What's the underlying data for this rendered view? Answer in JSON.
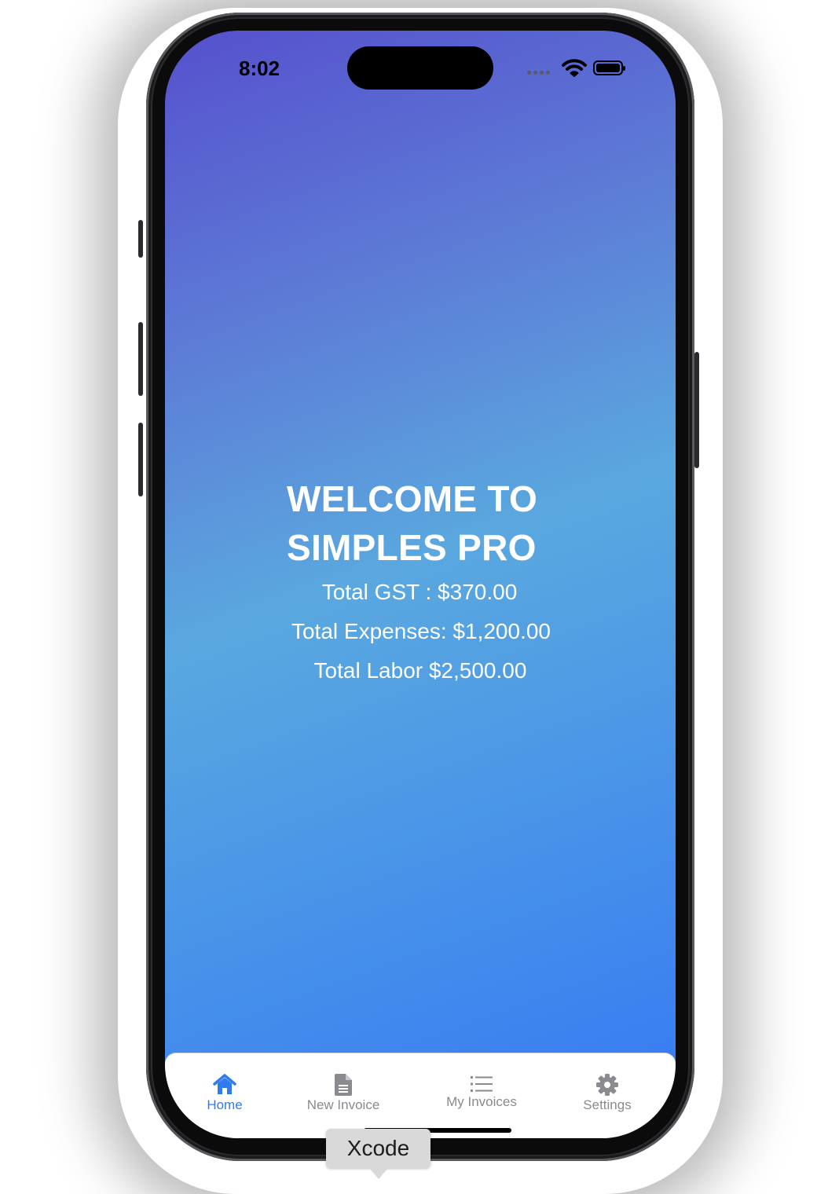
{
  "status_bar": {
    "time": "8:02"
  },
  "home": {
    "title_line1": "WELCOME TO",
    "title_line2": "SIMPLES PRO",
    "total_gst": "Total GST : $370.00",
    "total_expenses": "Total Expenses: $1,200.00",
    "total_labor": "Total Labor $2,500.00"
  },
  "tabbar": {
    "tabs": [
      {
        "label": "Home",
        "icon": "house-icon",
        "active": true
      },
      {
        "label": "New Invoice",
        "icon": "document-icon",
        "active": false
      },
      {
        "label": "My Invoices",
        "icon": "list-icon",
        "active": false
      },
      {
        "label": "Settings",
        "icon": "gear-icon",
        "active": false
      }
    ]
  },
  "tooltip": {
    "text": "Xcode"
  },
  "colors": {
    "gradient_top": "#5650cd",
    "gradient_mid": "#5aa8df",
    "gradient_bottom": "#3478f4",
    "tab_active": "#2f7bef",
    "tab_inactive": "#8a8a8f"
  }
}
